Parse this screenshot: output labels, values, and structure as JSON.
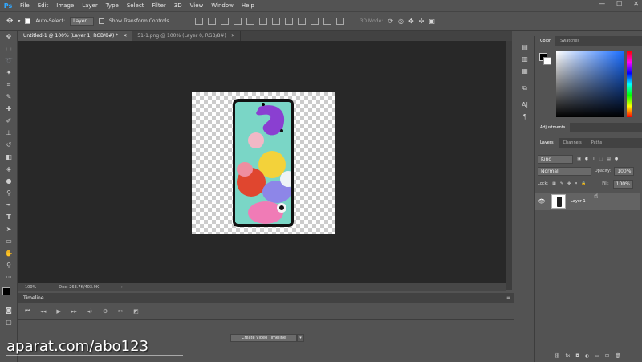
{
  "app": {
    "logo": "Ps"
  },
  "menubar": {
    "items": [
      "File",
      "Edit",
      "Image",
      "Layer",
      "Type",
      "Select",
      "Filter",
      "3D",
      "View",
      "Window",
      "Help"
    ],
    "minimize": "—",
    "maximize": "☐",
    "close": "✕"
  },
  "options": {
    "auto_select_label": "Auto-Select:",
    "auto_select_value": "Layer",
    "show_transform_label": "Show Transform Controls",
    "mode_3d": "3D Mode:"
  },
  "tabs": [
    {
      "label": "Untitled-1 @ 100% (Layer 1, RGB/8#) *"
    },
    {
      "label": "51-1.png @ 100% (Layer 0, RGB/8#)"
    }
  ],
  "status": {
    "zoom": "100%",
    "doc_info": "Doc: 263.7K/403.9K"
  },
  "timeline": {
    "title": "Timeline",
    "create_button": "Create Video Timeline"
  },
  "color_panel": {
    "tabs": [
      "Color",
      "Swatches"
    ]
  },
  "adjustments_panel": {
    "tab": "Adjustments"
  },
  "layers_panel": {
    "tabs": [
      "Layers",
      "Channels",
      "Paths"
    ],
    "kind": "Kind",
    "blend_mode": "Normal",
    "opacity_label": "Opacity:",
    "opacity_value": "100%",
    "lock_label": "Lock:",
    "fill_label": "Fill:",
    "fill_value": "100%",
    "layer_name": "Layer 1"
  },
  "watermark": "aparat.com/abo123",
  "colors": {
    "accent": "#31a8ff",
    "panel_bg": "#535353",
    "workspace": "#282828"
  }
}
